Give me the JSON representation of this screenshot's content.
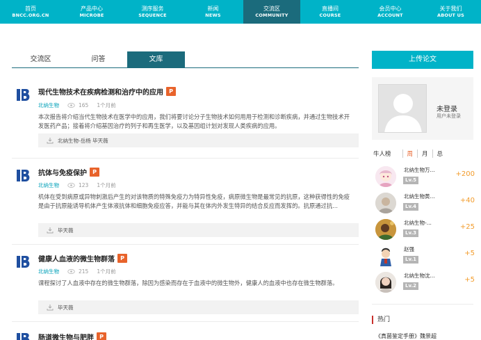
{
  "nav": {
    "items": [
      {
        "zh": "首页",
        "en": "BNCC.ORG.CN"
      },
      {
        "zh": "产品中心",
        "en": "MICROBE"
      },
      {
        "zh": "测序服务",
        "en": "SEQUENCE"
      },
      {
        "zh": "新闻",
        "en": "NEWS"
      },
      {
        "zh": "交流区",
        "en": "COMMUNITY"
      },
      {
        "zh": "直播间",
        "en": "COURSE"
      },
      {
        "zh": "会员中心",
        "en": "ACCOUNT"
      },
      {
        "zh": "关于我们",
        "en": "ABOUT US"
      }
    ],
    "active_index": 4
  },
  "tabs": [
    {
      "label": "交流区"
    },
    {
      "label": "问答"
    },
    {
      "label": "文库"
    }
  ],
  "articles": [
    {
      "title": "现代生物技术在疾病检测和治疗中的应用",
      "file_type": "P",
      "category": "北纳生物",
      "views": "165",
      "time": "1个月前",
      "desc": "本次报告将介绍当代生物技术在医学中的应用，我们将要讨论分子生物技术如何用用于检测和诊断疾病，并通过生物技术开发医药产品；接着将介绍基因治疗的列子和再生医学，以及基因组计划对发现人类疾病的应用。",
      "footer": "北纳生物-岳杨   毕天薇"
    },
    {
      "title": "抗体与免疫保护",
      "file_type": "P",
      "category": "北纳生物",
      "views": "123",
      "time": "1个月前",
      "desc": "机体在受到病原或异物刺激后产生的对该物质的特殊免疫力为特异性免疫，病原微生物是最常见的抗原，这种获得性的免疫是由于抗原能诱导机体产生体液抗体和细胞免疫应答，并能与其在体内外发生特异的结合反应而发挥的。抗原通过抗...",
      "footer": "毕天薇"
    },
    {
      "title": "健康人血液的微生物群落",
      "file_type": "P",
      "category": "北纳生物",
      "views": "215",
      "time": "1个月前",
      "desc": "课程探讨了人血液中存在的微生物群落，除因为感染而存在于血液中的微生物外，健康人的血液中也存在微生物群落。",
      "footer": "毕天薇"
    },
    {
      "title": "肠道微生物与肥胖",
      "file_type": "P"
    }
  ],
  "sidebar": {
    "upload_label": "上传论文",
    "login_title": "未登录",
    "login_sub": "用户未登录",
    "rank_label": "牛人榜",
    "periods": [
      "周",
      "月",
      "总"
    ],
    "active_period": 0,
    "ranking": [
      {
        "name": "北纳生物万...",
        "level": "Lv.5",
        "points": "+200"
      },
      {
        "name": "北纳生物黄...",
        "level": "Lv.4",
        "points": "+40"
      },
      {
        "name": "北纳生物-...",
        "level": "Lv.3",
        "points": "+25"
      },
      {
        "name": "赵强",
        "level": "Lv.1",
        "points": "+5"
      },
      {
        "name": "北纳生物沈...",
        "level": "Lv.2",
        "points": "+5"
      }
    ],
    "hot_label": "热门",
    "hot_item": "《真菌鉴定手册》魏景超"
  },
  "colors": {
    "nav_bg": "#00b3c8",
    "nav_active": "#1b6b7c",
    "ppt_orange": "#e8632b",
    "points": "#f29b2a",
    "category": "#00a0b8"
  }
}
